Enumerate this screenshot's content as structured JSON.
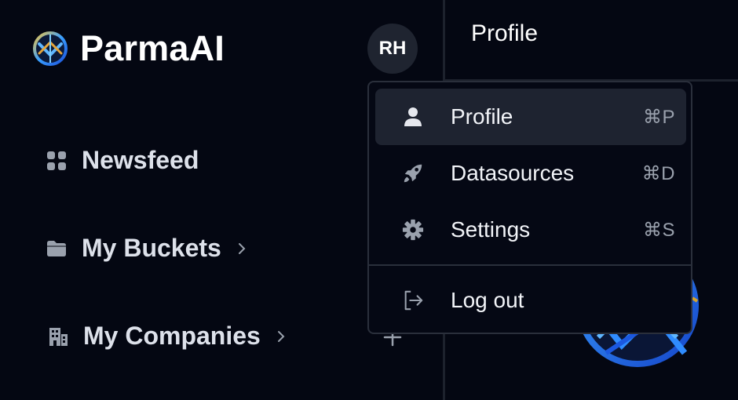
{
  "brand": {
    "name": "ParmaAI"
  },
  "avatar": {
    "initials": "RH"
  },
  "sidebar": {
    "items": [
      {
        "label": "Newsfeed",
        "icon": "grid-icon"
      },
      {
        "label": "My Buckets",
        "icon": "folder-icon"
      },
      {
        "label": "My Companies",
        "icon": "building-icon"
      }
    ]
  },
  "header": {
    "title": "Profile"
  },
  "user_menu": {
    "items": [
      {
        "label": "Profile",
        "shortcut": "⌘P",
        "icon": "user-icon"
      },
      {
        "label": "Datasources",
        "shortcut": "⌘D",
        "icon": "rocket-icon"
      },
      {
        "label": "Settings",
        "shortcut": "⌘S",
        "icon": "gear-icon"
      }
    ],
    "logout": {
      "label": "Log out",
      "icon": "logout-icon"
    }
  },
  "colors": {
    "background": "#040712",
    "menu_active": "#1e2330",
    "border": "#2a2f3b",
    "icon_muted": "#9aa1ad"
  }
}
